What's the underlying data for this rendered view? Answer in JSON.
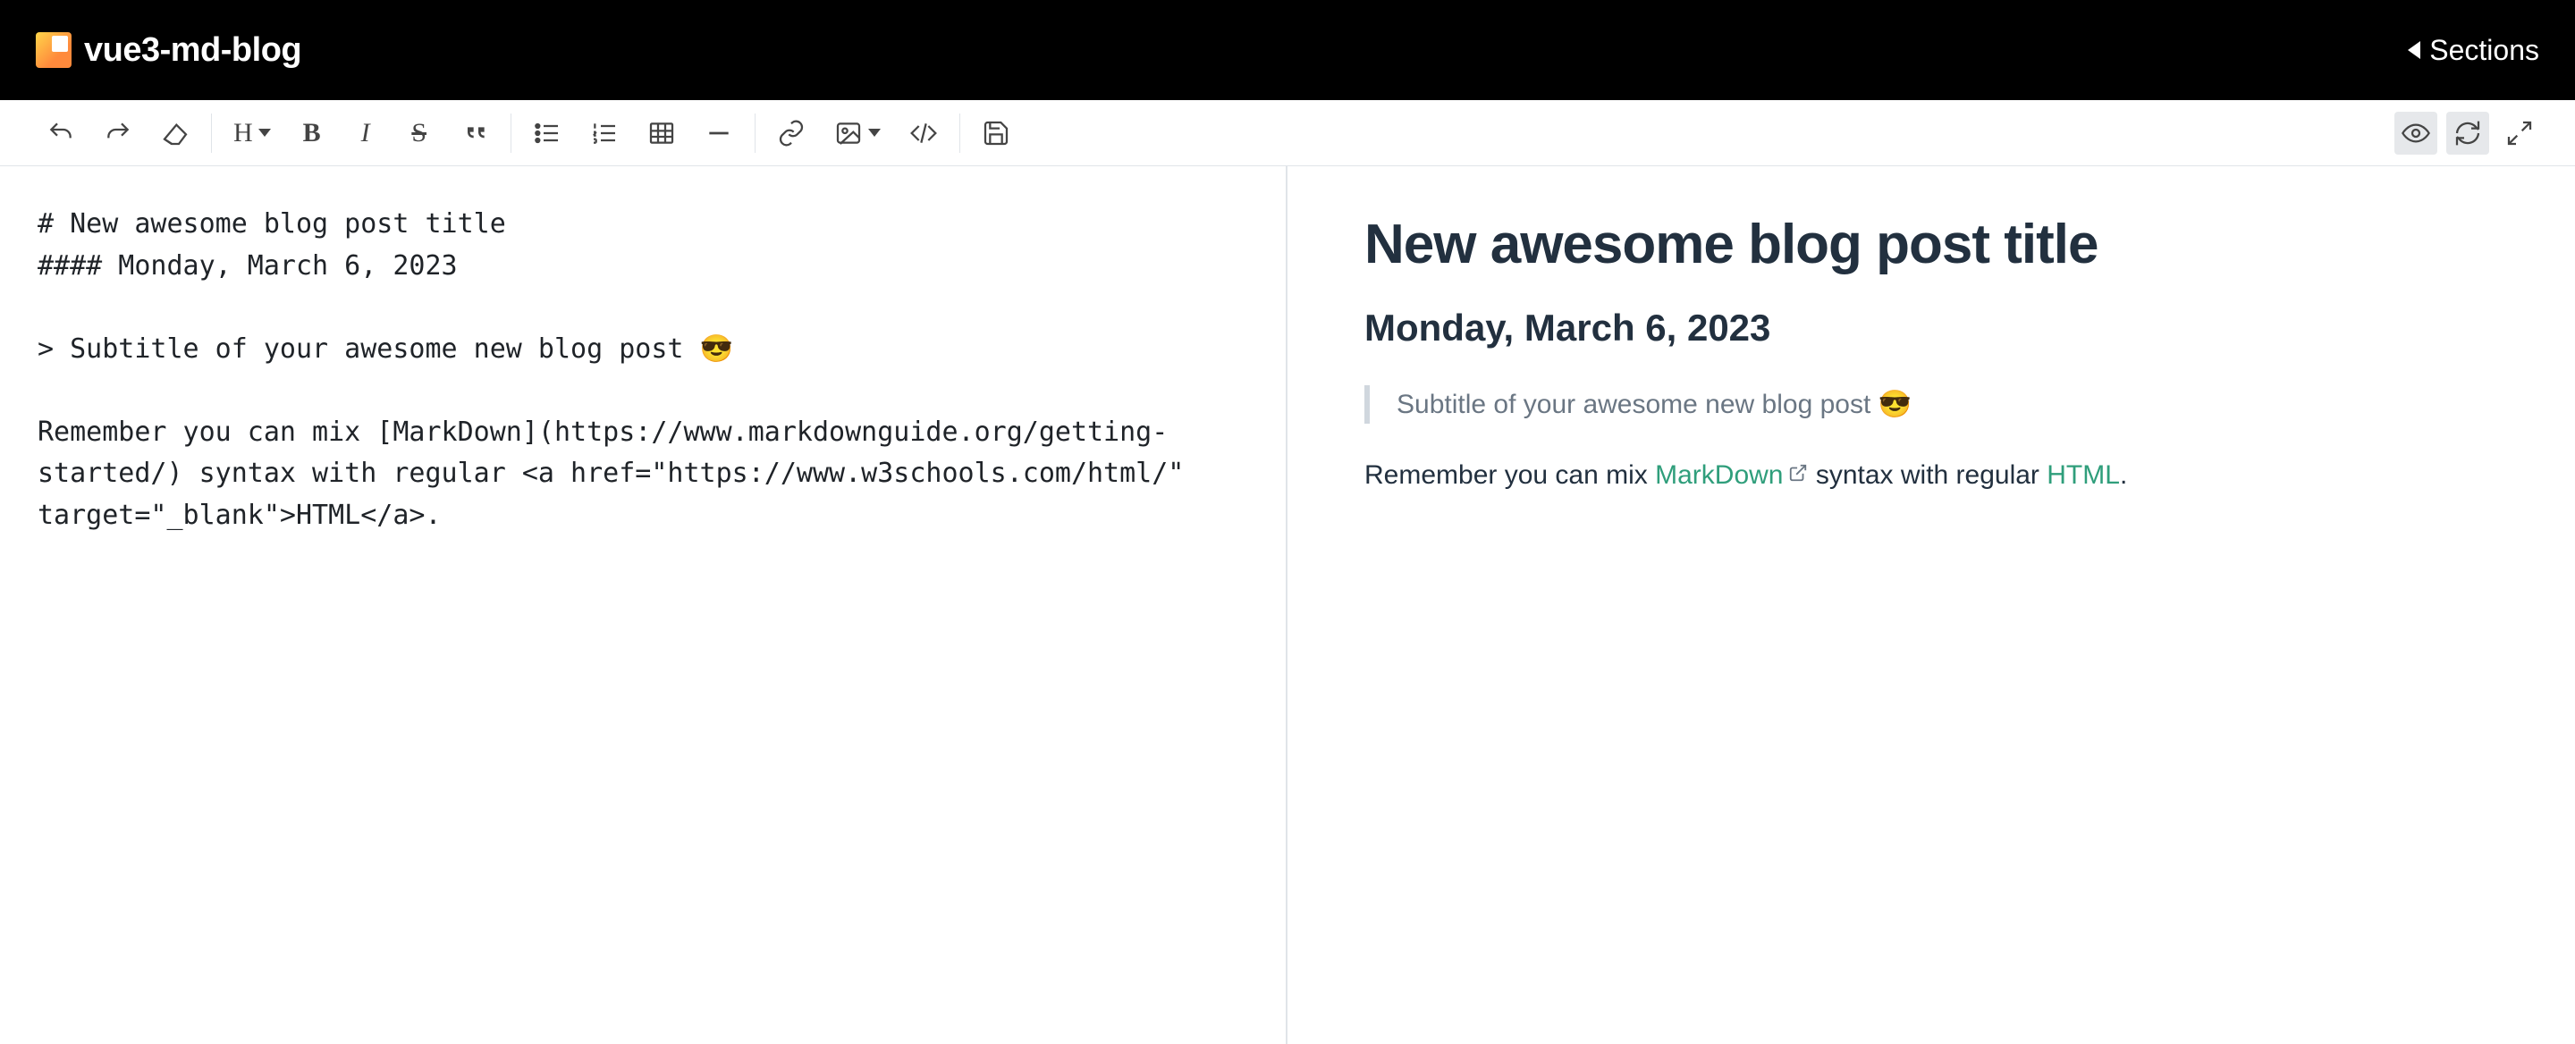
{
  "header": {
    "title": "vue3-md-blog",
    "sections_label": "Sections"
  },
  "toolbar": {
    "heading_label": "H"
  },
  "editor": {
    "content": "# New awesome blog post title\n#### Monday, March 6, 2023\n\n> Subtitle of your awesome new blog post 😎\n\nRemember you can mix [MarkDown](https://www.markdownguide.org/getting-started/) syntax with regular <a href=\"https://www.w3schools.com/html/\" target=\"_blank\">HTML</a>."
  },
  "preview": {
    "title": "New awesome blog post title",
    "date": "Monday, March 6, 2023",
    "subtitle": "Subtitle of your awesome new blog post 😎",
    "p_before": "Remember you can mix ",
    "link1": "MarkDown",
    "p_mid": " syntax with regular ",
    "link2": "HTML",
    "p_after": "."
  }
}
